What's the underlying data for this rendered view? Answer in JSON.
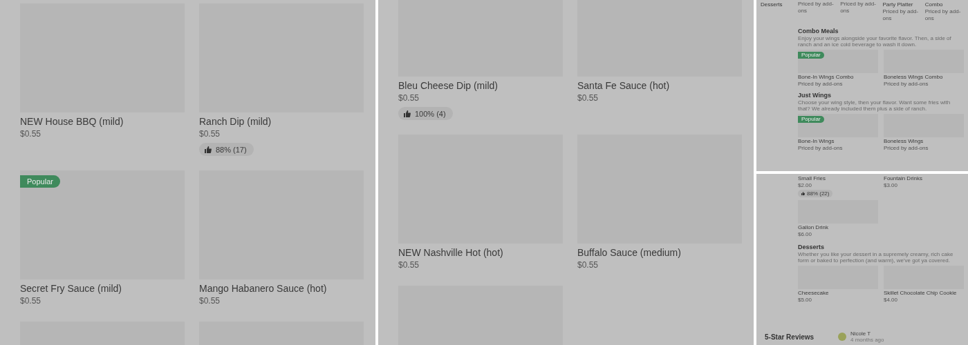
{
  "panels": [
    {
      "kind": "large_grid",
      "items": [
        {
          "kind": "full",
          "title": "NEW House BBQ (mild)",
          "price": "$0.55"
        },
        {
          "kind": "full",
          "title": "Ranch Dip (mild)",
          "price": "$0.55",
          "rating": "88% (17)"
        },
        {
          "kind": "full",
          "badge": "Popular",
          "title": "Secret Fry Sauce (mild)",
          "price": "$0.55"
        },
        {
          "kind": "full",
          "title": "Mango Habanero Sauce (hot)",
          "price": "$0.55"
        },
        {
          "kind": "image_only"
        },
        {
          "kind": "image_only"
        }
      ]
    },
    {
      "kind": "large_grid",
      "items": [
        {
          "kind": "full",
          "title": "Bleu Cheese Dip (mild)",
          "price": "$0.55",
          "rating": "100% (4)"
        },
        {
          "kind": "full",
          "title": "Santa Fe Sauce (hot)",
          "price": "$0.55"
        },
        {
          "kind": "full",
          "title": "NEW Nashville Hot (hot)",
          "price": "$0.55"
        },
        {
          "kind": "full",
          "title": "Buffalo Sauce (medium)",
          "price": "$0.55"
        },
        {
          "kind": "image_only"
        }
      ]
    },
    {
      "kind": "mini_menu",
      "sidebar": [
        {
          "label": "Desserts"
        }
      ],
      "blocks": [
        {
          "kind": "row",
          "items": [
            {
              "kind": "text_only",
              "price": "Priced by add-ons"
            },
            {
              "kind": "text_only",
              "price": "Priced by add-ons"
            },
            {
              "kind": "text_only",
              "title": "Party Platter",
              "price": "Priced by add-ons"
            },
            {
              "kind": "text_only",
              "title": "Combo",
              "price": "Priced by add-ons"
            }
          ]
        },
        {
          "kind": "section",
          "title": "Combo Meals",
          "description": "Enjoy your wings alongside your favorite flavor. Then, a side of ranch and an ice cold beverage to wash it down.",
          "items": [
            {
              "kind": "full",
              "badge": "Popular",
              "title": "Bone-In Wings Combo",
              "price": "Priced by add-ons"
            },
            {
              "kind": "full",
              "title": "Boneless Wings Combo",
              "price": "Priced by add-ons"
            }
          ]
        },
        {
          "kind": "section",
          "title": "Just Wings",
          "description": "Choose your wing style, then your flavor. Want some fries with that? We already included them plus a side of ranch.",
          "items": [
            {
              "kind": "full",
              "badge": "Popular",
              "title": "Bone-In Wings",
              "price": "Priced by add-ons"
            },
            {
              "kind": "full",
              "title": "Boneless Wings",
              "price": "Priced by add-ons"
            }
          ]
        }
      ]
    },
    {
      "kind": "mini_menu",
      "blocks": [
        {
          "kind": "row",
          "items": [
            {
              "kind": "text_only",
              "title": "Small Fries",
              "price": "$2.00",
              "rating": "88% (22)"
            },
            {
              "kind": "text_only",
              "title": "Fountain Drinks",
              "price": "$3.00"
            }
          ]
        },
        {
          "kind": "row",
          "items": [
            {
              "kind": "full",
              "title": "Gallon Drink",
              "price": "$6.00"
            }
          ]
        },
        {
          "kind": "section",
          "title": "Desserts",
          "description": "Whether you like your dessert in a supremely creamy, rich cake form or baked to perfection (and warm), we've got ya covered.",
          "items": [
            {
              "kind": "full",
              "title": "Cheesecake",
              "price": "$5.00"
            },
            {
              "kind": "full",
              "title": "Skillet Chocolate Chip Cookie",
              "price": "$4.00"
            }
          ]
        }
      ],
      "reviews": {
        "heading": "5-Star Reviews",
        "name": "Nicole T",
        "time": "4 months ago"
      }
    }
  ]
}
